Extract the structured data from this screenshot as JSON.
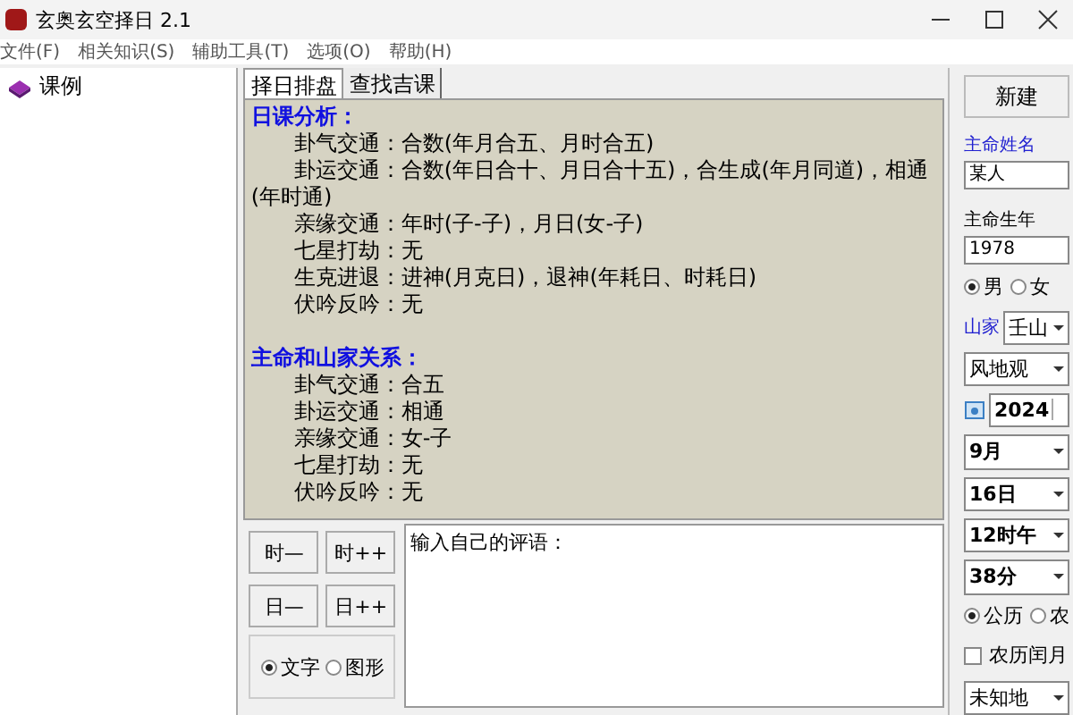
{
  "window": {
    "title": "玄奥玄空择日 2.1"
  },
  "menu": [
    "文件(F)",
    "相关知识(S)",
    "辅助工具(T)",
    "选项(O)",
    "帮助(H)"
  ],
  "tree": [
    {
      "label": "课例"
    }
  ],
  "tabs": [
    {
      "label": "择日排盘",
      "selected": true
    },
    {
      "label": "查找吉课",
      "selected": false
    }
  ],
  "analysis": [
    {
      "heading": "日课分析：",
      "lines": [
        "卦气交通：合数(年月合五、月时合五)",
        "卦运交通：合数(年日合十、月日合十五)，合生成(年月同道)，相通(年时通)",
        "亲缘交通：年时(子-子)，月日(女-子)",
        "七星打劫：无",
        "生克进退：进神(月克日)，退神(年耗日、时耗日)",
        "伏吟反吟：无"
      ]
    },
    {
      "heading": "主命和山家关系：",
      "lines": [
        "卦气交通：合五",
        "卦运交通：相通",
        "亲缘交通：女-子",
        "七星打劫：无",
        "伏吟反吟：无"
      ]
    }
  ],
  "step_buttons": [
    "时—",
    "时++",
    "日—",
    "日++"
  ],
  "display_mode": [
    {
      "label": "文字",
      "selected": true
    },
    {
      "label": "图形",
      "selected": false
    }
  ],
  "comment": {
    "value": "输入自己的评语："
  },
  "side": {
    "new_button": "新建",
    "name_label": "主命姓名",
    "name_value": "某人",
    "birth_label": "主命生年",
    "birth_value": "1978",
    "gender": [
      {
        "label": "男",
        "selected": true
      },
      {
        "label": "女",
        "selected": false
      }
    ],
    "mountain_label": "山家",
    "mountain": "壬山",
    "view": "风地观",
    "year": "2024",
    "dropdowns": [
      "9月",
      "16日",
      "12时午",
      "38分"
    ],
    "calendar": [
      {
        "label": "公历",
        "selected": true
      },
      {
        "label": "农",
        "selected": false
      }
    ],
    "leap_month": {
      "label": "农历闰月",
      "checked": false
    },
    "place": "未知地"
  }
}
